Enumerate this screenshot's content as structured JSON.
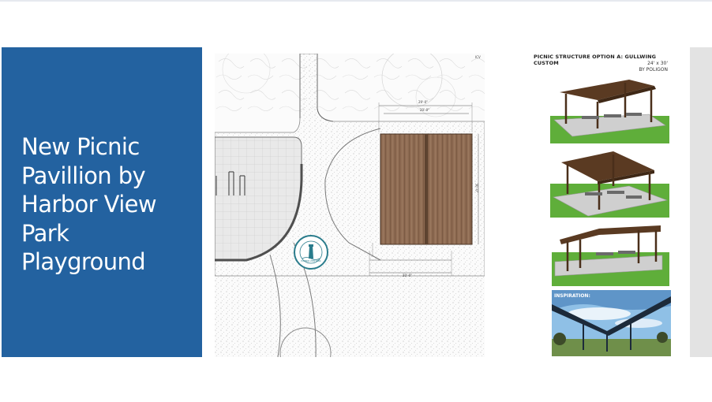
{
  "slide": {
    "title": "New Picnic\nPavillion by\nHarbor View\nPark\nPlayground"
  },
  "plan": {
    "north_label": "ICV",
    "dim_top": "29'-0\"",
    "dim_inner": "20'-0\"",
    "dim_right": "30'-0\"",
    "dim_bottom": "20'-0\"",
    "seal_text": "HARBOR VIEW PARK"
  },
  "renders": {
    "option_title": "PICNIC STRUCTURE OPTION A: GULLWING CUSTOM",
    "size": "24' x 30'",
    "by": "BY POLIGON",
    "inspiration_label": "INSPIRATION:"
  },
  "colors": {
    "title_panel": "#2362a0",
    "title_text": "#ffffff",
    "roof_brown": "#5a3a22",
    "grass": "#5fae3a",
    "sky": "#8fc0e6",
    "scrollbar": "#e3e3e3"
  },
  "icons": {
    "seal": "park-seal-icon"
  }
}
